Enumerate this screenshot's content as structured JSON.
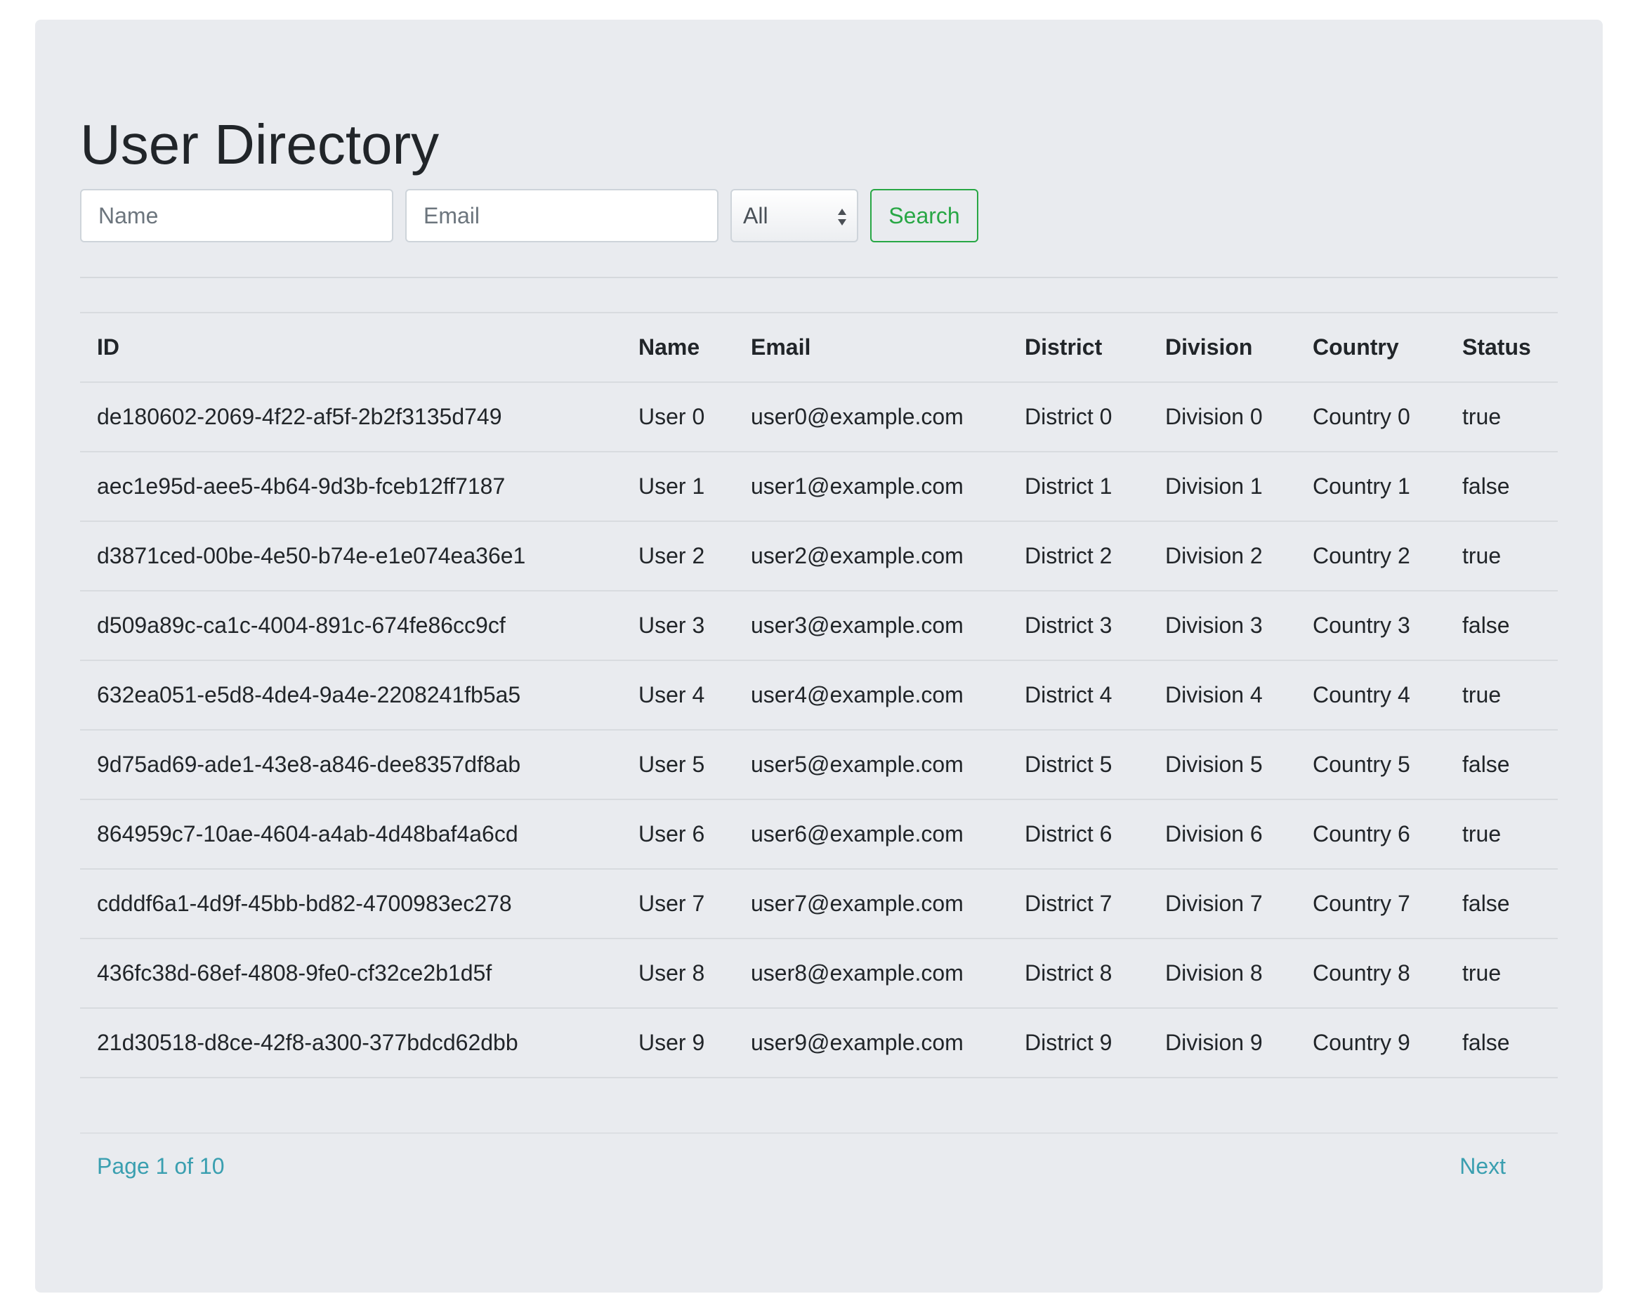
{
  "page": {
    "title": "User Directory"
  },
  "filters": {
    "name_placeholder": "Name",
    "email_placeholder": "Email",
    "status_selected": "All",
    "search_label": "Search"
  },
  "table": {
    "headers": [
      "ID",
      "Name",
      "Email",
      "District",
      "Division",
      "Country",
      "Status"
    ],
    "rows": [
      [
        "de180602-2069-4f22-af5f-2b2f3135d749",
        "User 0",
        "user0@example.com",
        "District 0",
        "Division 0",
        "Country 0",
        "true"
      ],
      [
        "aec1e95d-aee5-4b64-9d3b-fceb12ff7187",
        "User 1",
        "user1@example.com",
        "District 1",
        "Division 1",
        "Country 1",
        "false"
      ],
      [
        "d3871ced-00be-4e50-b74e-e1e074ea36e1",
        "User 2",
        "user2@example.com",
        "District 2",
        "Division 2",
        "Country 2",
        "true"
      ],
      [
        "d509a89c-ca1c-4004-891c-674fe86cc9cf",
        "User 3",
        "user3@example.com",
        "District 3",
        "Division 3",
        "Country 3",
        "false"
      ],
      [
        "632ea051-e5d8-4de4-9a4e-2208241fb5a5",
        "User 4",
        "user4@example.com",
        "District 4",
        "Division 4",
        "Country 4",
        "true"
      ],
      [
        "9d75ad69-ade1-43e8-a846-dee8357df8ab",
        "User 5",
        "user5@example.com",
        "District 5",
        "Division 5",
        "Country 5",
        "false"
      ],
      [
        "864959c7-10ae-4604-a4ab-4d48baf4a6cd",
        "User 6",
        "user6@example.com",
        "District 6",
        "Division 6",
        "Country 6",
        "true"
      ],
      [
        "cdddf6a1-4d9f-45bb-bd82-4700983ec278",
        "User 7",
        "user7@example.com",
        "District 7",
        "Division 7",
        "Country 7",
        "false"
      ],
      [
        "436fc38d-68ef-4808-9fe0-cf32ce2b1d5f",
        "User 8",
        "user8@example.com",
        "District 8",
        "Division 8",
        "Country 8",
        "true"
      ],
      [
        "21d30518-d8ce-42f8-a300-377bdcd62dbb",
        "User 9",
        "user9@example.com",
        "District 9",
        "Division 9",
        "Country 9",
        "false"
      ]
    ]
  },
  "pagination": {
    "page_info": "Page 1 of 10",
    "next_label": "Next"
  },
  "colors": {
    "panel_background": "#e9ebef",
    "search_accent": "#28a745",
    "link": "#3a9fb0"
  },
  "icons": {
    "select_arrows": "up-down-chevron-icon"
  }
}
